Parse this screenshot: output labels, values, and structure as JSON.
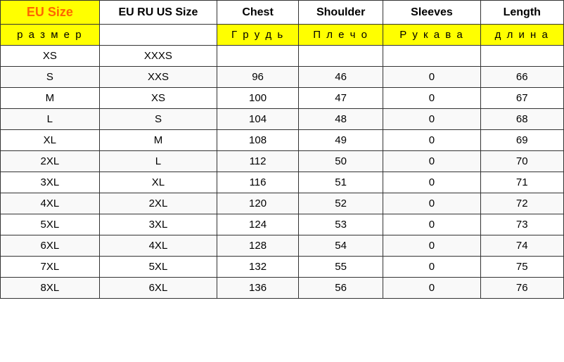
{
  "table": {
    "headers": [
      {
        "label": "EU Size",
        "sublabel": "р а з м е р"
      },
      {
        "label": "EU RU US Size",
        "sublabel": ""
      },
      {
        "label": "Chest",
        "sublabel": "Г р у д ь"
      },
      {
        "label": "Shoulder",
        "sublabel": "П л е ч о"
      },
      {
        "label": "Sleeves",
        "sublabel": "Р у к а в а"
      },
      {
        "label": "Length",
        "sublabel": "д л и н а"
      }
    ],
    "rows": [
      {
        "eu": "XS",
        "other": "XXXS",
        "chest": "",
        "shoulder": "",
        "sleeves": "",
        "length": ""
      },
      {
        "eu": "S",
        "other": "XXS",
        "chest": "96",
        "shoulder": "46",
        "sleeves": "0",
        "length": "66"
      },
      {
        "eu": "M",
        "other": "XS",
        "chest": "100",
        "shoulder": "47",
        "sleeves": "0",
        "length": "67"
      },
      {
        "eu": "L",
        "other": "S",
        "chest": "104",
        "shoulder": "48",
        "sleeves": "0",
        "length": "68"
      },
      {
        "eu": "XL",
        "other": "M",
        "chest": "108",
        "shoulder": "49",
        "sleeves": "0",
        "length": "69"
      },
      {
        "eu": "2XL",
        "other": "L",
        "chest": "112",
        "shoulder": "50",
        "sleeves": "0",
        "length": "70"
      },
      {
        "eu": "3XL",
        "other": "XL",
        "chest": "116",
        "shoulder": "51",
        "sleeves": "0",
        "length": "71"
      },
      {
        "eu": "4XL",
        "other": "2XL",
        "chest": "120",
        "shoulder": "52",
        "sleeves": "0",
        "length": "72"
      },
      {
        "eu": "5XL",
        "other": "3XL",
        "chest": "124",
        "shoulder": "53",
        "sleeves": "0",
        "length": "73"
      },
      {
        "eu": "6XL",
        "other": "4XL",
        "chest": "128",
        "shoulder": "54",
        "sleeves": "0",
        "length": "74"
      },
      {
        "eu": "7XL",
        "other": "5XL",
        "chest": "132",
        "shoulder": "55",
        "sleeves": "0",
        "length": "75"
      },
      {
        "eu": "8XL",
        "other": "6XL",
        "chest": "136",
        "shoulder": "56",
        "sleeves": "0",
        "length": "76"
      }
    ]
  }
}
